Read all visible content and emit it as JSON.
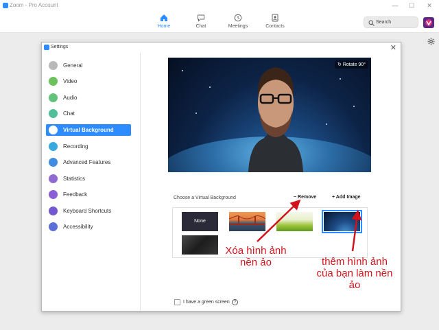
{
  "window": {
    "title": "Zoom - Pro Account"
  },
  "nav": {
    "tabs": [
      {
        "label": "Home"
      },
      {
        "label": "Chat"
      },
      {
        "label": "Meetings"
      },
      {
        "label": "Contacts"
      }
    ],
    "search_placeholder": "Search"
  },
  "settings": {
    "title": "Settings",
    "sidebar": [
      {
        "label": "General",
        "icon": "gear-icon",
        "color": "#b9b9b9"
      },
      {
        "label": "Video",
        "icon": "video-icon",
        "color": "#6cc15d"
      },
      {
        "label": "Audio",
        "icon": "audio-icon",
        "color": "#62c27a"
      },
      {
        "label": "Chat",
        "icon": "chat-icon",
        "color": "#4fbf9a"
      },
      {
        "label": "Virtual Background",
        "icon": "virtual-background-icon",
        "color": "#ffffff"
      },
      {
        "label": "Recording",
        "icon": "recording-icon",
        "color": "#39a7e0"
      },
      {
        "label": "Advanced Features",
        "icon": "advanced-features-icon",
        "color": "#3e8ce0"
      },
      {
        "label": "Statistics",
        "icon": "statistics-icon",
        "color": "#8e6ad1"
      },
      {
        "label": "Feedback",
        "icon": "feedback-icon",
        "color": "#8a5fd6"
      },
      {
        "label": "Keyboard Shortcuts",
        "icon": "keyboard-icon",
        "color": "#7357d0"
      },
      {
        "label": "Accessibility",
        "icon": "accessibility-icon",
        "color": "#5b6fd6"
      }
    ],
    "active_item": "Virtual Background",
    "preview": {
      "rotate_label": "Rotate 90°"
    },
    "virtual_background": {
      "heading": "Choose a Virtual Background",
      "remove_label": "Remove",
      "add_label": "Add Image",
      "none_label": "None",
      "thumbnails": [
        "None",
        "Golden Gate Bridge",
        "Grass",
        "Earth from space",
        "Dark texture"
      ],
      "selected": "Earth from space"
    },
    "green_screen_label": "I have a green screen"
  },
  "annotations": {
    "remove_note": "Xóa hình ảnh nền ảo",
    "add_note": "thêm hình ảnh của bạn làm nền ảo",
    "color": "#d3131b"
  },
  "colors": {
    "accent": "#2d8cff"
  }
}
